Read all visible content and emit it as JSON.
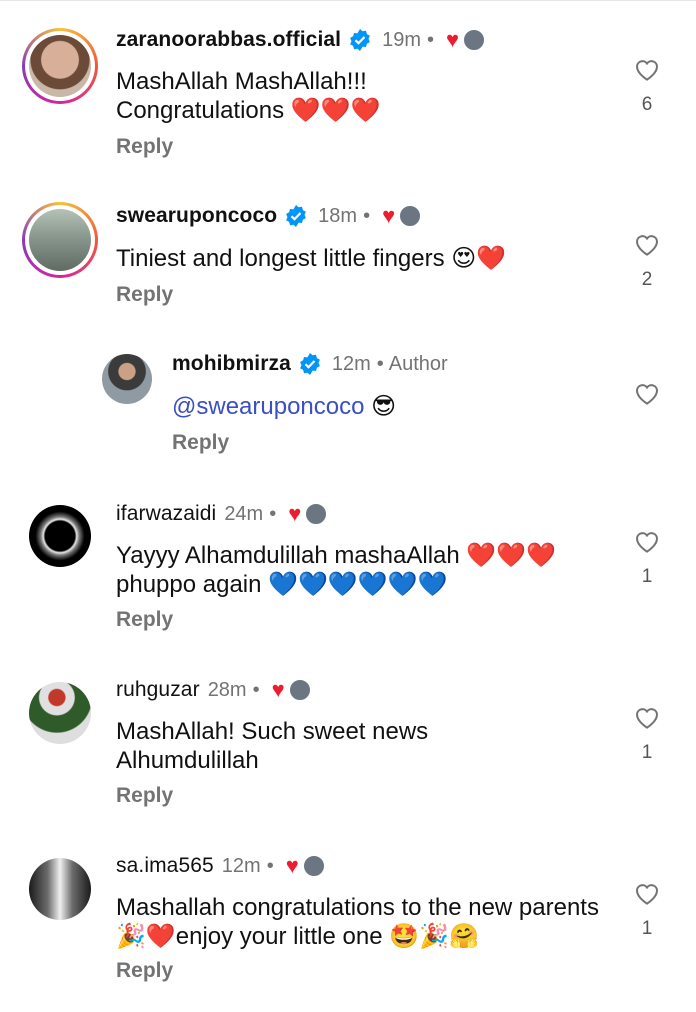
{
  "comments": [
    {
      "username": "zaranoorabbas.official",
      "verified": true,
      "time": "19m",
      "dot": "•",
      "author": "",
      "text": "MashAllah MashAllah!!! Congratulations ❤️❤️❤️",
      "reply": "Reply",
      "likes": "6"
    },
    {
      "username": "swearuponcoco",
      "verified": true,
      "time": "18m",
      "dot": "•",
      "author": "",
      "text": "Tiniest and longest little fingers 😍❤️",
      "reply": "Reply",
      "likes": "2"
    },
    {
      "username": "mohibmirza",
      "verified": true,
      "time": "12m",
      "dot": "•",
      "author": "Author",
      "mention": "@swearuponcoco",
      "text": " 😎",
      "reply": "Reply",
      "likes": ""
    },
    {
      "username": "ifarwazaidi",
      "verified": false,
      "time": "24m",
      "dot": "•",
      "author": "",
      "text": "Yayyy Alhamdulillah mashaAllah ❤️❤️❤️ phuppo again 💙💙💙💙💙💙",
      "reply": "Reply",
      "likes": "1"
    },
    {
      "username": "ruhguzar",
      "verified": false,
      "time": "28m",
      "dot": "•",
      "author": "",
      "text": "MashAllah! Such sweet news Alhumdulillah",
      "reply": "Reply",
      "likes": "1"
    },
    {
      "username": "sa.ima565",
      "verified": false,
      "time": "12m",
      "dot": "•",
      "author": "",
      "text": "Mashallah congratulations to the new parents 🎉❤️enjoy your little one 🤩🎉🤗",
      "reply": "Reply",
      "likes": "1"
    }
  ],
  "colors": {
    "accent_heart": "#ed1c2e",
    "verified": "#0095f6",
    "mention": "#3b4ec2",
    "meta": "#737373"
  },
  "icons": {
    "like": "heart-outline-icon",
    "verified": "verified-badge-icon",
    "liked_by_author": "heart-filled-icon"
  }
}
